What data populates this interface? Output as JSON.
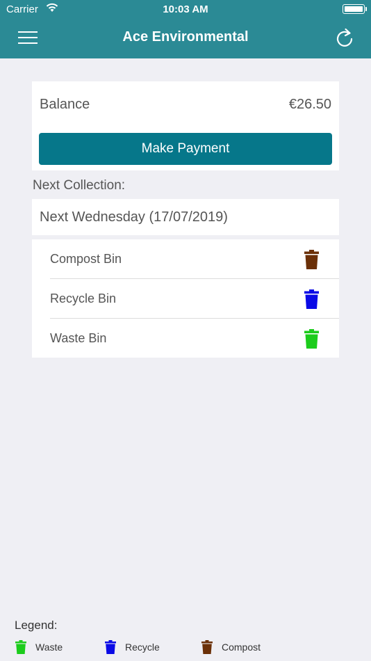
{
  "status_bar": {
    "carrier": "Carrier",
    "time": "10:03 AM"
  },
  "header": {
    "title": "Ace Environmental",
    "menu_icon": "hamburger-menu-icon",
    "refresh_icon": "refresh-icon"
  },
  "balance": {
    "label": "Balance",
    "value": "€26.50",
    "button_label": "Make Payment"
  },
  "next_collection": {
    "label": "Next Collection:",
    "date": "Next Wednesday (17/07/2019)",
    "bins": [
      {
        "label": "Compost Bin",
        "icon": "trash-bin-icon",
        "color": "#6b3008"
      },
      {
        "label": "Recycle Bin",
        "icon": "trash-bin-icon",
        "color": "#0a0ae6"
      },
      {
        "label": "Waste Bin",
        "icon": "trash-bin-icon",
        "color": "#1ccc1c"
      }
    ]
  },
  "legend": {
    "title": "Legend:",
    "items": [
      {
        "label": "Waste",
        "color": "#1ccc1c"
      },
      {
        "label": "Recycle",
        "color": "#0a0ae6"
      },
      {
        "label": "Compost",
        "color": "#6b3008"
      }
    ]
  },
  "colors": {
    "header": "#2b8a95",
    "button": "#06778a",
    "background": "#efeff4"
  }
}
